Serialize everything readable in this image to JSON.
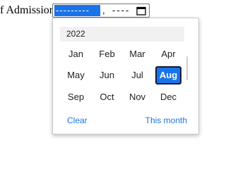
{
  "form": {
    "label": "f Admission:",
    "date_input": {
      "month_placeholder": "---------",
      "separator": ",",
      "year_placeholder": "----",
      "calendar_icon": "calendar-icon"
    }
  },
  "picker": {
    "year": "2022",
    "months": [
      "Jan",
      "Feb",
      "Mar",
      "Apr",
      "May",
      "Jun",
      "Jul",
      "Aug",
      "Sep",
      "Oct",
      "Nov",
      "Dec"
    ],
    "selected_month": "Aug",
    "clear_label": "Clear",
    "this_month_label": "This month"
  },
  "colors": {
    "accent": "#1a73e8",
    "selected_border": "#0f1c3a",
    "header_bg": "#f1f1f1"
  }
}
